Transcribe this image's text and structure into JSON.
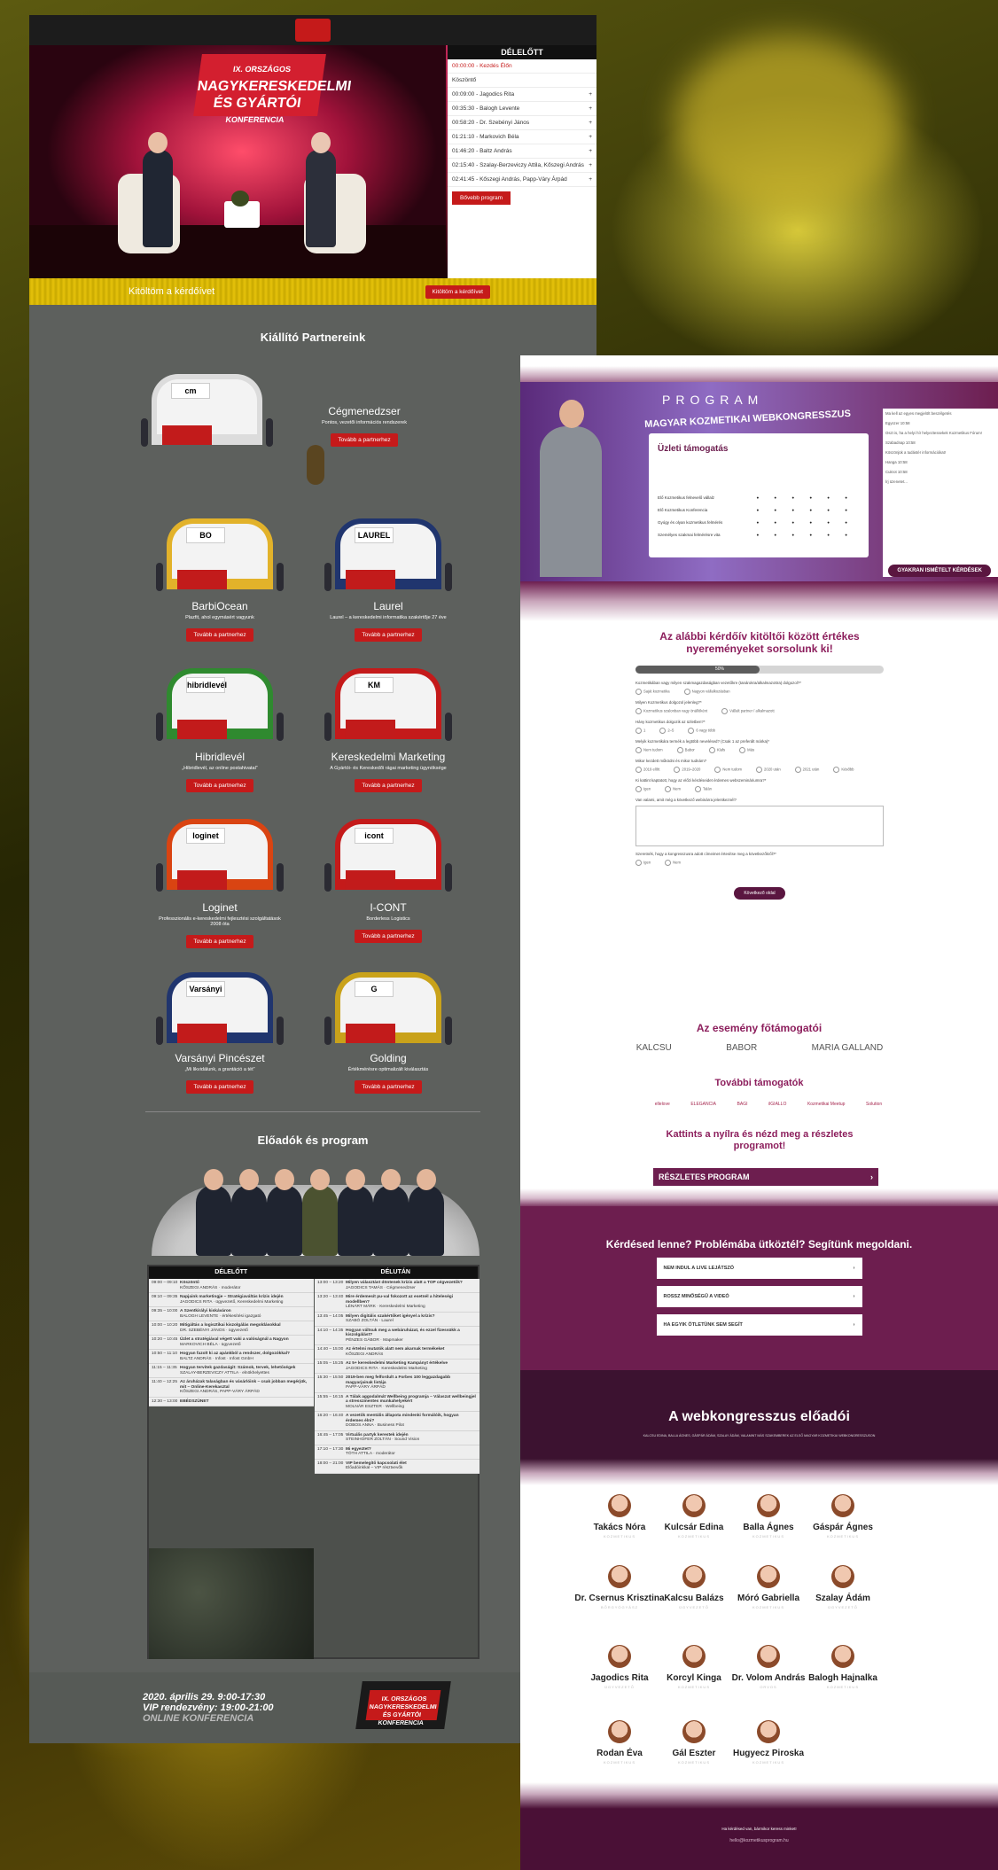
{
  "left": {
    "topbar": {
      "logo_text": "IX. ORSZÁGOS NAGYKERESKEDELMI ÉS GYÁRTÓI"
    },
    "hero": {
      "sign": {
        "line1": "IX. ORSZÁGOS",
        "line2": "NAGYKERESKEDELMI",
        "line3": "ÉS GYÁRTÓI",
        "line4": "KONFERENCIA"
      },
      "agenda_title": "DÉLELŐTT",
      "agenda_items": [
        "00:00:00 - Kezdés Élőn",
        "Köszöntő",
        "00:09:00 - Jagodics Rita",
        "00:35:30 - Balogh Levente",
        "00:58:20 - Dr. Szebényi János",
        "01:21:10 - Markovich Béla",
        "01:46:20 - Baltz András",
        "02:15:40 - Szalay-Berzeviczy Attila, Kőszegi András",
        "02:41:45 - Kőszegi András, Papp-Váry Árpád"
      ],
      "agenda_button": "Bővebb program"
    },
    "survey_bar": {
      "text": "Kitöltöm a kérdőívet",
      "button": "Kitöltöm a kérdőívet"
    },
    "partners_title": "Kiállító Partnereink",
    "exhibitors": [
      {
        "name": "Cégmenedzser",
        "desc": "Pontos, vezetői információs rendszerek",
        "button": "Tovább a partnerhez",
        "logo": "cm"
      },
      {
        "name": "BarbiOcean",
        "desc": "Plazfit, ahol egymásért vagyunk",
        "button": "Tovább a partnerhez",
        "logo": "BO"
      },
      {
        "name": "Laurel",
        "desc": "Laurel – a kereskedelmi informatika szakértője 27 éve",
        "button": "Tovább a partnerhez",
        "logo": "LAUREL"
      },
      {
        "name": "Hibridlevél",
        "desc": "„Hibridlevél, az online postahivatal”",
        "button": "Tovább a partnerhez",
        "logo": "hibridlevél"
      },
      {
        "name": "Kereskedelmi Marketing",
        "desc": "A Gyártói- és Kereskedői rágai marketing ügynöksége",
        "button": "Tovább a partnerhez",
        "logo": "KM"
      },
      {
        "name": "Loginet",
        "desc": "Professzionális e-kereskedelmi fejlesztési szolgáltatások 2008 óta",
        "button": "Tovább a partnerhez",
        "logo": "loginet"
      },
      {
        "name": "I-CONT",
        "desc": "Borderless Logistics",
        "button": "Tovább a partnerhez",
        "logo": "icont"
      },
      {
        "name": "Varsányi Pincészet",
        "desc": "„Mi likvidálunk, a grantáció a tét”",
        "button": "Tovább a partnerhez",
        "logo": "Varsányi"
      },
      {
        "name": "Golding",
        "desc": "Értékmérésre optimalizált kiválasztás",
        "button": "Tovább a partnerhez",
        "logo": "G"
      }
    ],
    "speakers_title": "Előadók és program",
    "program": {
      "am": "DÉLELŐTT",
      "pm": "DÉLUTÁN",
      "am_rows": [
        {
          "t": "09:00 – 09:10",
          "title": "Köszöntő",
          "sub": "KŐSZEGI ANDRÁS · moderátor"
        },
        {
          "t": "09:10 – 09:35",
          "title": "Napjaink marketingje – Stratégiaváltás krízis idején",
          "sub": "JAGODICS RITA · ügyvezető, Kereskedelmi Marketing"
        },
        {
          "t": "09:35 – 10:00",
          "title": "A Szentkirályi kiskáváron",
          "sub": "BALOGH LEVENTE · értékesítési igazgató"
        },
        {
          "t": "10:00 – 10:20",
          "title": "Mitigáltás a logisztikai kiszolgálás megoldásokkal",
          "sub": "DR. SZEBÉNYI JÁNOS · ügyvezető"
        },
        {
          "t": "10:20 – 10:45",
          "title": "Üzlet a stratégiával végett vaki a valóságnál a Nagyon",
          "sub": "MARKOVICH BÉLA · ügyvezető"
        },
        {
          "t": "10:50 – 11:10",
          "title": "Hogyan fazolt ki az apánkból a rendszer, dolgozókkal?",
          "sub": "BALTZ ANDRÁS · Infost · Infost GmbH"
        },
        {
          "t": "11:15 – 11:35",
          "title": "Hogyan tervitek gazdaságit: Számok, tervek, lehetőségek",
          "sub": "SZALAY-BERZEVICZY ATTILA · elnökhelyettes"
        },
        {
          "t": "11:40 – 12:25",
          "title": "Az áruházak talaságban és vásárlóink – csak jobban megérjük, mit – Online-Kerekasztal",
          "sub": "KŐSZEGI ANDRÁS, PAPP-VÁRY ÁRPÁD"
        },
        {
          "t": "12:30 – 13:00",
          "title": "EBÉDSZÜNET",
          "sub": ""
        }
      ],
      "pm_rows": [
        {
          "t": "13:00 – 13:20",
          "title": "Milyen választást döntenek krízis alatt a TOP cégvezetők?",
          "sub": "JAGODICS TAMÁS · Cégmenedzser"
        },
        {
          "t": "13:20 – 13:40",
          "title": "Mire érdemesít pu-val fokozott az esetnél a hiteleségi modellben?",
          "sub": "LÉNÁRT MÁRK · Kereskedelmi Marketing"
        },
        {
          "t": "13:45 – 14:05",
          "title": "Milyen digitális szakértőket igényel a krízis?",
          "sub": "SZABÓ ZOLTÁN · Laurel"
        },
        {
          "t": "14:10 – 14:35",
          "title": "Hogyan váltsuk meg a webáruházat, és ezzel fizessükk a kiszolgálást?",
          "sub": "PÉNZES GÁBOR · Mapmaker"
        },
        {
          "t": "14:40 – 15:00",
          "title": "Az értelmi mutatók alatt nem akarnak termékeket",
          "sub": "KŐSZEGI ANDRÁS"
        },
        {
          "t": "15:05 – 15:25",
          "title": "Az 5+ kereskedelmi Marketing Kampányt értékelve",
          "sub": "JAGODICS RITA · Kereskedelmi Marketing"
        },
        {
          "t": "15:30 – 15:50",
          "title": "2019-ben meg felfordult a Forbes 100 leggazdagabb magyarjainak listája",
          "sub": "PAPP-VÁRY ÁRPÁD"
        },
        {
          "t": "15:55 – 16:15",
          "title": "A Tálak aggodalmát Wellbeing programja – Válaszat wellbeingjel a stresszmentes munkahelyekért",
          "sub": "MOLNÁR ESZTER · Wellbeing"
        },
        {
          "t": "16:20 – 16:40",
          "title": "A vezetők mentális állapota mindenki formálóik, hogyan érdemes élni?",
          "sub": "DOBOS ANNA · Business Pilot"
        },
        {
          "t": "16:45 – 17:05",
          "title": "Virtuális partyk kerestek idején",
          "sub": "STEINHOFER ZOLTÁN · Sound Vision"
        },
        {
          "t": "17:10 – 17:30",
          "title": "Mi egyeztet?",
          "sub": "TÓTH ATTILA · moderátor"
        },
        {
          "t": "18:00 – 21:00",
          "title": "VIP bemelegítő kapcsolati élet",
          "sub": "Előadóinkkal – VIP résztvevők"
        }
      ]
    },
    "footer": {
      "line1": "2020. április 29. 9:00-17:30",
      "line2": "VIP rendezvény: 19:00-21:00",
      "line3": "ONLINE KONFERENCIA",
      "logo1": "IX. ORSZÁGOS",
      "logo2": "NAGYKERESKEDELMI",
      "logo3": "ÉS GYÁRTÓI",
      "logo4": "KONFERENCIA"
    }
  },
  "right": {
    "hero": {
      "banner": "MAGYAR KOZMETIKAI WEBKONGRESSZUS",
      "program_word": "PROGRAM",
      "slide_title": "Üzleti támogatás",
      "slide_rows": [
        "Elő Kozmetikus felnevelő vállalz",
        "Elő Kozmetikus Konferencia",
        "Gyógy és olyan kozmetikus felmérés",
        "Személyes szakmai felmérésre vita"
      ],
      "chat": [
        "Ma kell az egyes megjelölt beszélgetés",
        "Egyszer 10:58",
        "Oszt is, ha a helyi hír helyeztessekek Kozmetikus Fórum!",
        "Szabadnap 10:58",
        "Köszönjük a tudástér információkat!",
        "Hanga 10:58",
        "Cukrot 10:58",
        "Írj üzenetet..."
      ],
      "chat_button": "GYAKRAN ISMÉTELT KÉRDÉSEK"
    },
    "survey": {
      "title": "Az alábbi kérdőív kitöltői között értékes nyereményeket sorsolunk ki!",
      "progress_label": "50%",
      "progress": 0.5,
      "questions": [
        {
          "q": "Kozmetikában vagy milyen szakmagazdaságban vezetőkre (tanárokra/alkalmazottra) dolgozol?*",
          "opts": [
            "Saját kozmetika",
            "Nagyon vállalkozásban"
          ]
        },
        {
          "q": "Milyen Kozmetikus dolgozol jelenleg?*",
          "opts": [
            "Kozmetikus szalonban vagy önállóként",
            "Vállalt partner / alkalmazott"
          ]
        },
        {
          "q": "Hány kozmetikus dolgozik az üzletben?*",
          "opts": [
            "1",
            "2–5",
            "6 vagy több"
          ]
        },
        {
          "q": "Melyik kozmetikára termék a legtöbb nevelésed? (Csak 1 az preferált márka)*",
          "opts": [
            "Nem tudom",
            "Babor",
            "Klafs",
            "Más"
          ]
        },
        {
          "q": "Mikor kezdett működni és mikor tudnám?",
          "opts": [
            "2019 előtt",
            "2019–2020",
            "Nem tudom",
            "2020 után",
            "2021 után",
            "Később"
          ]
        },
        {
          "q": "Ki kattint kaptatott, hogy az előzi kérdéseidet érdemes webszemináriumra?*",
          "opts": [
            "Igen",
            "Nem",
            "Talán"
          ]
        },
        {
          "q": "Van valami, amit még a következő webinárra jelentkeznél?",
          "opts": []
        },
        {
          "q": "Szeretnék, hogy a kongresszusra adott címeimet értesítse meg a következőkről?*",
          "opts": [
            "Igen",
            "Nem"
          ]
        }
      ],
      "submit": "Következő oldal"
    },
    "main_sponsors_title": "Az esemény főtámogatói",
    "main_sponsors": [
      "KALCSU",
      "BABOR",
      "MARIA GALLAND"
    ],
    "more_sponsors_title": "További támogatók",
    "more_sponsors": [
      "ellelove",
      "ELEGANCIA",
      "BAGI",
      "ilGIALLO",
      "Kozmetikai Meetup",
      "Solution"
    ],
    "program_title": "Kattints a nyílra és nézd meg a részletes programot!",
    "program_button": "RÉSZLETES PROGRAM",
    "faq_title": "Kérdésed lenne? Problémába ütköztél? Segítünk megoldani.",
    "faq_buttons": [
      "NEM INDUL A LIVE LEJÁTSZÓ",
      "ROSSZ MINŐSÉGŰ A VIDEÓ",
      "HA EGYIK ÖTLETÜNK SEM SEGÍT"
    ],
    "speakers_title": "A webkongresszus előadói",
    "speakers_sub": "KALCSU EDINA, BALLA ÁGNES, GÁSPÁR ÁDÁM, SZALAY ÁDÁM, VALAMINT MÁS SZAKEMBEREK AZ ELSŐ MAGYAR KOZMETIKAI WEBKONGRESSZUSON",
    "speakers": [
      {
        "name": "Takács Nóra",
        "role": "KOZMETIKUS"
      },
      {
        "name": "Kulcsár Edina",
        "role": "KOZMETIKUS"
      },
      {
        "name": "Balla Ágnes",
        "role": "KOZMETIKUS"
      },
      {
        "name": "Gáspár Ágnes",
        "role": "KOZMETIKUS"
      },
      {
        "name": "Dr. Csernus Krisztina",
        "role": "BŐRGYÓGYÁSZ"
      },
      {
        "name": "Kalcsu Balázs",
        "role": "ÜGYVEZETŐ"
      },
      {
        "name": "Móró Gabriella",
        "role": "KOZMETIKUS"
      },
      {
        "name": "Szalay Ádám",
        "role": "ÜGYVEZETŐ"
      },
      {
        "name": "Jagodics Rita",
        "role": "ÜGYVEZETŐ"
      },
      {
        "name": "Korcyl Kinga",
        "role": "KOZMETIKUS"
      },
      {
        "name": "Dr. Volom András",
        "role": "ORVOS"
      },
      {
        "name": "Balogh Hajnalka",
        "role": "KOZMETIKUS"
      },
      {
        "name": "Rodan Éva",
        "role": "KOZMETIKUS"
      },
      {
        "name": "Gál Eszter",
        "role": "KOZMETIKUS"
      },
      {
        "name": "Hugyecz Piroska",
        "role": "KOZMETIKUS"
      }
    ],
    "footer": {
      "text": "Ha kérdésed van, bármikor keress minket!",
      "email": "hello@kozmetikusprogram.hu"
    }
  }
}
